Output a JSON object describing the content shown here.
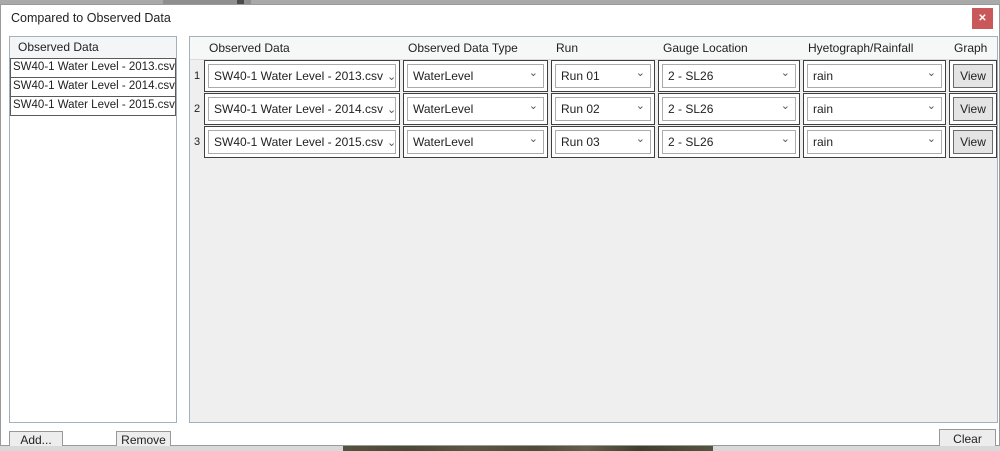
{
  "window": {
    "title": "Compared to Observed Data"
  },
  "icons": {
    "close": "✕",
    "chevron_down": "⌄"
  },
  "colors": {
    "close_button_red": "#c9585a",
    "panel_border_blue_gray": "#a3b1bf",
    "grid_background": "#efefef",
    "cell_border_dark": "#3f3f3f",
    "background_aerial_olive": "#4f4c3a"
  },
  "left_panel": {
    "header": "Observed Data",
    "items": [
      "SW40-1 Water Level - 2013.csv",
      "SW40-1 Water Level - 2014.csv",
      "SW40-1 Water Level - 2015.csv"
    ]
  },
  "table": {
    "columns": [
      "Observed Data",
      "Observed Data Type",
      "Run",
      "Gauge Location",
      "Hyetograph/Rainfall",
      "Graph"
    ],
    "rows": [
      {
        "num": "1",
        "observed_data": "SW40-1 Water Level - 2013.csv",
        "observed_data_type": "WaterLevel",
        "run": "Run 01",
        "gauge_location": "2 - SL26",
        "hyetograph": "rain",
        "graph_label": "View"
      },
      {
        "num": "2",
        "observed_data": "SW40-1 Water Level - 2014.csv",
        "observed_data_type": "WaterLevel",
        "run": "Run 02",
        "gauge_location": "2 - SL26",
        "hyetograph": "rain",
        "graph_label": "View"
      },
      {
        "num": "3",
        "observed_data": "SW40-1 Water Level - 2015.csv",
        "observed_data_type": "WaterLevel",
        "run": "Run 03",
        "gauge_location": "2 - SL26",
        "hyetograph": "rain",
        "graph_label": "View"
      }
    ]
  },
  "buttons": {
    "add": "Add...",
    "remove": "Remove",
    "clear": "Clear"
  }
}
